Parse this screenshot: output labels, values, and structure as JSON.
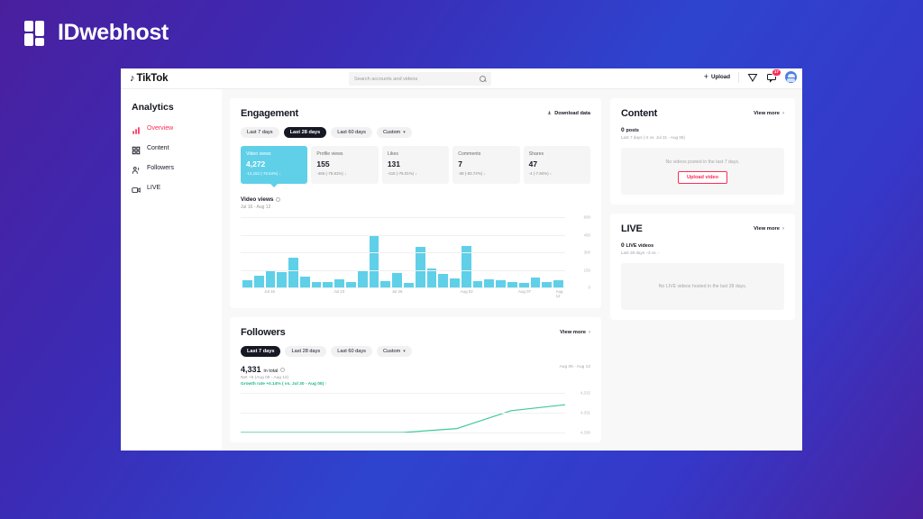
{
  "brand": {
    "name": "IDwebhost",
    "mark": "idwebhost-logo-mark"
  },
  "topbar": {
    "logo_note": "♪",
    "logo_word": "TikTok",
    "search_placeholder": "Search accounts and videos",
    "search_icon": "search-icon",
    "upload_label": "Upload",
    "upload_plus": "+",
    "send_icon": "paper-plane-icon",
    "message_icon": "message-icon",
    "message_badge": "17",
    "avatar": "user-avatar"
  },
  "sidebar": {
    "title": "Analytics",
    "items": [
      {
        "label": "Overview",
        "icon": "bar-chart-icon",
        "active": true
      },
      {
        "label": "Content",
        "icon": "grid-icon",
        "active": false
      },
      {
        "label": "Followers",
        "icon": "people-icon",
        "active": false
      },
      {
        "label": "LIVE",
        "icon": "live-video-icon",
        "active": false
      }
    ]
  },
  "engagement": {
    "title": "Engagement",
    "download_label": "Download data",
    "download_icon": "download-icon",
    "tabs": [
      {
        "label": "Last 7 days",
        "active": false
      },
      {
        "label": "Last 28 days",
        "active": true
      },
      {
        "label": "Last 60 days",
        "active": false
      },
      {
        "label": "Custom",
        "active": false,
        "caret": "▾"
      }
    ],
    "metrics": [
      {
        "label": "Video views",
        "value": "4,272",
        "delta": "-13,152 (-75.54%)",
        "arrow": "↓",
        "selected": true
      },
      {
        "label": "Profile views",
        "value": "155",
        "delta": "-465 (-75.81%)",
        "arrow": "↓",
        "selected": false
      },
      {
        "label": "Likes",
        "value": "131",
        "delta": "-415 (-76.01%)",
        "arrow": "↓",
        "selected": false
      },
      {
        "label": "Comments",
        "value": "7",
        "delta": "-38 (-83.72%)",
        "arrow": "↓",
        "selected": false
      },
      {
        "label": "Shares",
        "value": "47",
        "delta": "-4 (-7.84%)",
        "arrow": "↓",
        "selected": false
      }
    ]
  },
  "content_card": {
    "title": "Content",
    "view_more": "View more",
    "chevron": "›",
    "count": "0",
    "count_unit": "posts",
    "meta": "Last 7 days (-2 vs. Jul 31 - Aug 06)",
    "empty_text": "No videos posted in the last 7 days.",
    "button_label": "Upload video"
  },
  "live_card": {
    "title": "LIVE",
    "view_more": "View more",
    "chevron": "›",
    "count": "0",
    "count_unit": "LIVE videos",
    "meta": "Last 28 days −3 vs. -",
    "empty_text": "No LIVE videos hosted in the last 28 days."
  },
  "followers_card": {
    "title": "Followers",
    "view_more": "View more",
    "chevron": "›",
    "tabs": [
      {
        "label": "Last 7 days",
        "active": true
      },
      {
        "label": "Last 28 days",
        "active": false
      },
      {
        "label": "Last 60 days",
        "active": false
      },
      {
        "label": "Custom",
        "active": false,
        "caret": "▾"
      }
    ],
    "total": "4,331",
    "total_unit": "in total",
    "info_icon": "info-icon",
    "net": "Net +6 (Aug 06 - Aug 12)",
    "growth": "Growth rate +0.14% ( vs. Jul 30 - Aug 05)",
    "growth_arrow": "↑",
    "range": "Aug 06 - Aug 12"
  },
  "colors": {
    "accent_pink": "#fe2c55",
    "bar_cyan": "#5fd0e8",
    "growth_green": "#20b887",
    "dark": "#161823"
  },
  "chart_data": [
    {
      "type": "bar",
      "title": "Video views",
      "subtitle": "Jul 16 - Aug 12",
      "ylabel": "",
      "xlabel": "",
      "ylim": [
        0,
        600
      ],
      "yticks": [
        "0",
        "150",
        "300",
        "450",
        "600"
      ],
      "ytick_values": [
        0,
        150,
        300,
        450,
        600
      ],
      "grid": true,
      "categories": [
        "Jul 16",
        "Jul 17",
        "Jul 18",
        "Jul 19",
        "Jul 20",
        "Jul 21",
        "Jul 22",
        "Jul 23",
        "Jul 24",
        "Jul 25",
        "Jul 26",
        "Jul 27",
        "Jul 28",
        "Jul 29",
        "Jul 30",
        "Jul 31",
        "Aug 01",
        "Aug 02",
        "Aug 03",
        "Aug 04",
        "Aug 05",
        "Aug 06",
        "Aug 07",
        "Aug 08",
        "Aug 09",
        "Aug 10",
        "Aug 11",
        "Aug 12"
      ],
      "xtick_labels": [
        "Jul 16",
        "Jul 23",
        "Jul 26",
        "Aug 02",
        "Aug 07",
        "Aug 12"
      ],
      "xtick_indices": [
        2,
        8,
        13,
        19,
        24,
        27
      ],
      "values": [
        60,
        100,
        150,
        130,
        255,
        95,
        45,
        48,
        72,
        50,
        140,
        450,
        55,
        120,
        38,
        345,
        160,
        118,
        75,
        355,
        55,
        70,
        62,
        45,
        40,
        85,
        45,
        60
      ]
    },
    {
      "type": "line",
      "title": "Followers",
      "subtitle": "Aug 06 - Aug 12",
      "ylim": [
        4330,
        4332
      ],
      "yticks": [
        "4,330",
        "4,331",
        "4,332"
      ],
      "ytick_values": [
        4330,
        4331,
        4332
      ],
      "grid": true,
      "series": [
        {
          "name": "Followers",
          "color": "#3fc99a",
          "values": [
            4330,
            4330,
            4330,
            4330,
            4330.2,
            4331.1,
            4331.4
          ]
        }
      ],
      "x": [
        "Aug 06",
        "Aug 07",
        "Aug 08",
        "Aug 09",
        "Aug 10",
        "Aug 11",
        "Aug 12"
      ]
    }
  ]
}
